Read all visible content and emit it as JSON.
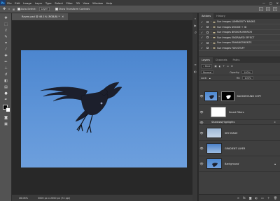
{
  "menubar": {
    "logo": "Ps",
    "items": [
      "File",
      "Edit",
      "Image",
      "Layer",
      "Type",
      "Select",
      "Filter",
      "3D",
      "View",
      "Window",
      "Help"
    ],
    "window_controls": [
      "—",
      "□",
      "✕"
    ]
  },
  "options": {
    "auto_select_label": "Auto-Select:",
    "auto_select_value": "Layer",
    "transform_label": "Show Transform Controls"
  },
  "document": {
    "tab_title": "Raven.psd @ 46.1% (RGB/8) *",
    "zoom": "46.06%",
    "doc_info": "3000 px x 2000 px (72 ppi)"
  },
  "actions_panel": {
    "tabs": [
      "Actions",
      "History"
    ],
    "items": [
      "Sue Images LUMINOSITY MASKS",
      "Sue Images DODGE + ID",
      "Sue Images BROKEN MIRROR",
      "Sue Images ENGRAVED EFFECT",
      "Sue Images ENHANCEMENTS",
      "Sue Images FUN STUFF"
    ]
  },
  "layers_panel": {
    "tabs": [
      "Layers",
      "Channels",
      "Paths"
    ],
    "filter_kind": "Kind",
    "blend_mode": "Normal",
    "opacity_label": "Opacity:",
    "opacity_value": "100%",
    "lock_label": "Lock:",
    "fill_label": "Fill:",
    "fill_value": "100%",
    "layers": [
      {
        "name": "BACKGROUND COPY"
      },
      {
        "name": "Smart Filters"
      },
      {
        "name": "Shadows/Highlights"
      },
      {
        "name": "SKY IMAGE"
      },
      {
        "name": "GRADIENT LAYER"
      },
      {
        "name": "Background"
      }
    ]
  },
  "colors": {
    "accent": "#31a8ff",
    "sky": "#5b92d6",
    "panel": "#3f3f3f"
  }
}
